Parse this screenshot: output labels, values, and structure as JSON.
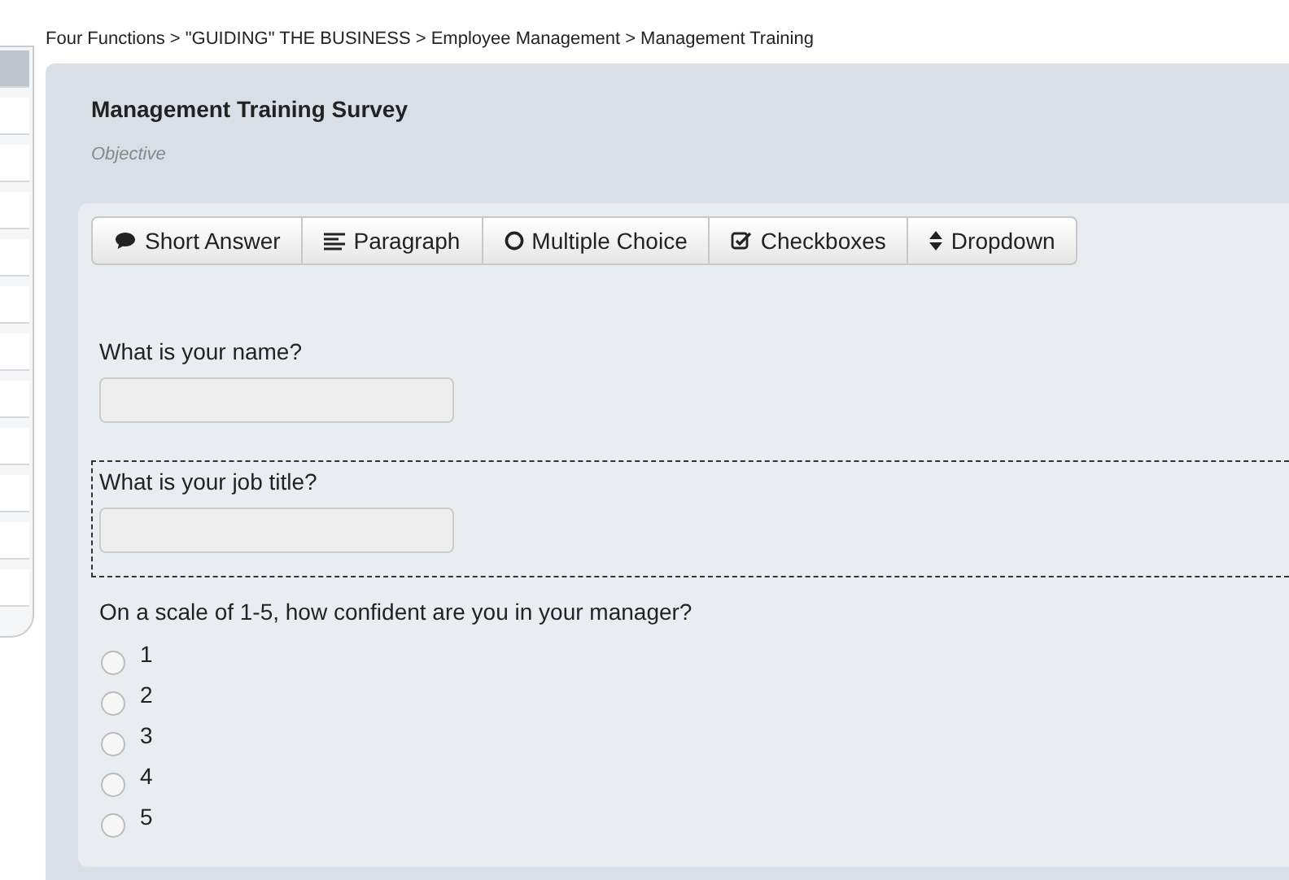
{
  "breadcrumb": "Four Functions > \"GUIDING\" THE BUSINESS > Employee Management > Management Training",
  "survey": {
    "title": "Management Training Survey",
    "subtitle": "Objective"
  },
  "toolbar": [
    {
      "kind": "short",
      "label": "Short Answer"
    },
    {
      "kind": "paragraph",
      "label": "Paragraph"
    },
    {
      "kind": "multiple",
      "label": "Multiple Choice"
    },
    {
      "kind": "checkboxes",
      "label": "Checkboxes"
    },
    {
      "kind": "dropdown",
      "label": "Dropdown"
    }
  ],
  "questions": [
    {
      "kind": "text",
      "label": "What is your name?",
      "selected": false
    },
    {
      "kind": "text",
      "label": "What is your job title?",
      "selected": true
    },
    {
      "kind": "radio",
      "label": "On a scale of 1-5, how confident are you in your manager?",
      "selected": false,
      "options": [
        {
          "label": "1",
          "checked": false
        },
        {
          "label": "2",
          "checked": false
        },
        {
          "label": "3",
          "checked": false
        },
        {
          "label": "4",
          "checked": false
        },
        {
          "label": "5",
          "checked": false
        }
      ]
    }
  ]
}
